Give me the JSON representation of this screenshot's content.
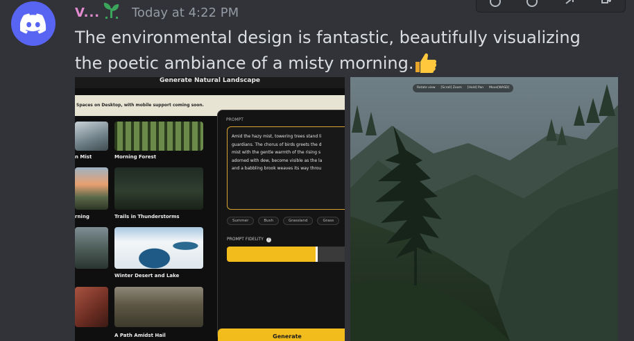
{
  "message": {
    "username": "V...",
    "timestamp": "Today at 4:22 PM",
    "text": "The environmental design is fantastic, beautifully visualizing the poetic ambiance of a misty morning."
  },
  "app": {
    "title": "Generate Natural Landscape",
    "subtitle": "Spaces on Desktop, with mobile support coming soon.",
    "gallery": [
      {
        "label": "n Mist"
      },
      {
        "label": "Morning Forest"
      },
      {
        "label": "rning"
      },
      {
        "label": "Trails in Thunderstorms"
      },
      {
        "label": "Winter Desert and Lake"
      },
      {
        "label": "A Path Amidst Hail"
      }
    ],
    "prompt_heading": "PROMPT",
    "prompt_lines": [
      "Amid the hazy mist, towering trees stand li",
      "guardians. The chorus of birds greets the d",
      "mist with the gentle warmth of the rising s",
      "adorned with dew, become visible as the la",
      "and a babbling brook weaves its way throu"
    ],
    "tags": [
      "Summer",
      "Bush",
      "Grassland",
      "Grass"
    ],
    "fidelity_label": "PROMPT FIDELITY",
    "fidelity_value": 0.68,
    "generate_label": "Generate"
  },
  "viewer": {
    "controls": [
      "Rotate view",
      "[Scroll] Zoom",
      "[Hold] Pan",
      "Move[WASD]"
    ]
  },
  "colors": {
    "background": "#313338",
    "accent": "#f2bd1c",
    "avatar": "#5865f2",
    "username": "#e38bd0"
  }
}
